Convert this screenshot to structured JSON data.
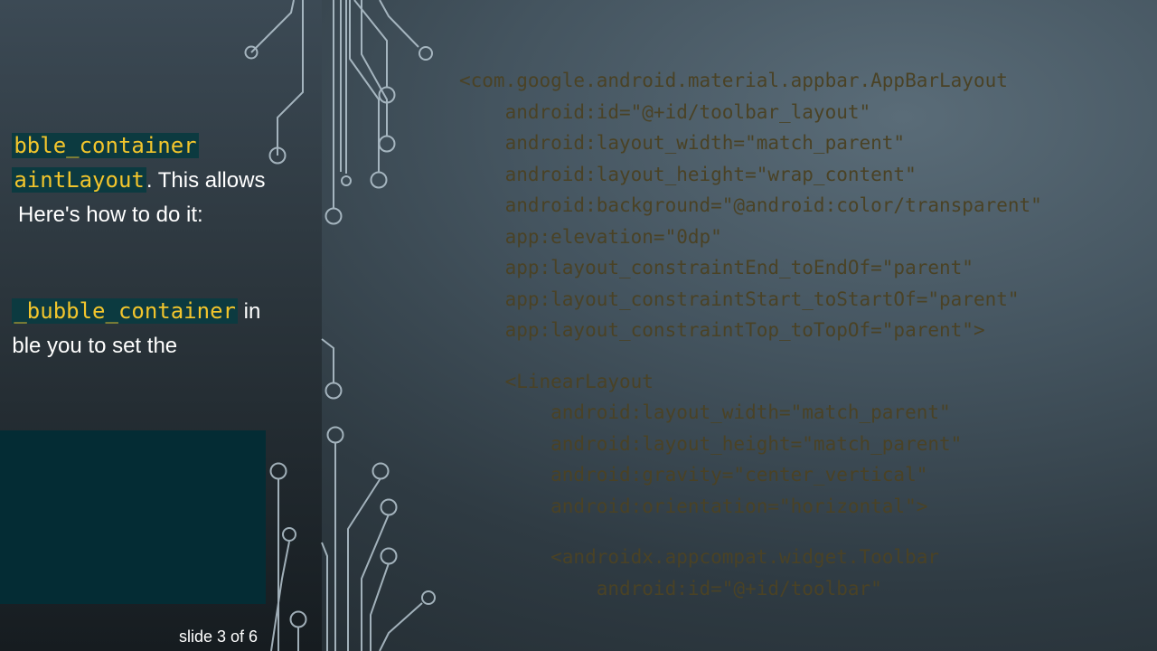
{
  "text_panel": {
    "line1": {
      "code": "bble_container"
    },
    "line2": {
      "code": "aintLayout",
      "text": ". This allows"
    },
    "line3": {
      "text": " Here's how to do it:"
    },
    "line4": {
      "code": "_bubble_container",
      "text": " in"
    },
    "line5": {
      "text": "ble you to set the"
    }
  },
  "slide_indicator": "slide 3 of 6",
  "code": {
    "lines": [
      "<com.google.android.material.appbar.AppBarLayout",
      "    android:id=\"@+id/toolbar_layout\"",
      "    android:layout_width=\"match_parent\"",
      "    android:layout_height=\"wrap_content\"",
      "    android:background=\"@android:color/transparent\"",
      "    app:elevation=\"0dp\"",
      "    app:layout_constraintEnd_toEndOf=\"parent\"",
      "    app:layout_constraintStart_toStartOf=\"parent\"",
      "    app:layout_constraintTop_toTopOf=\"parent\">",
      "",
      "    <LinearLayout",
      "        android:layout_width=\"match_parent\"",
      "        android:layout_height=\"match_parent\"",
      "        android:gravity=\"center_vertical\"",
      "        android:orientation=\"horizontal\">",
      "",
      "        <androidx.appcompat.widget.Toolbar",
      "            android:id=\"@+id/toolbar\""
    ]
  },
  "colors": {
    "highlight_bg": "#0c3a40",
    "highlight_text": "#f2c52c",
    "code_text": "#4a4225",
    "code_box": "#042c34"
  }
}
